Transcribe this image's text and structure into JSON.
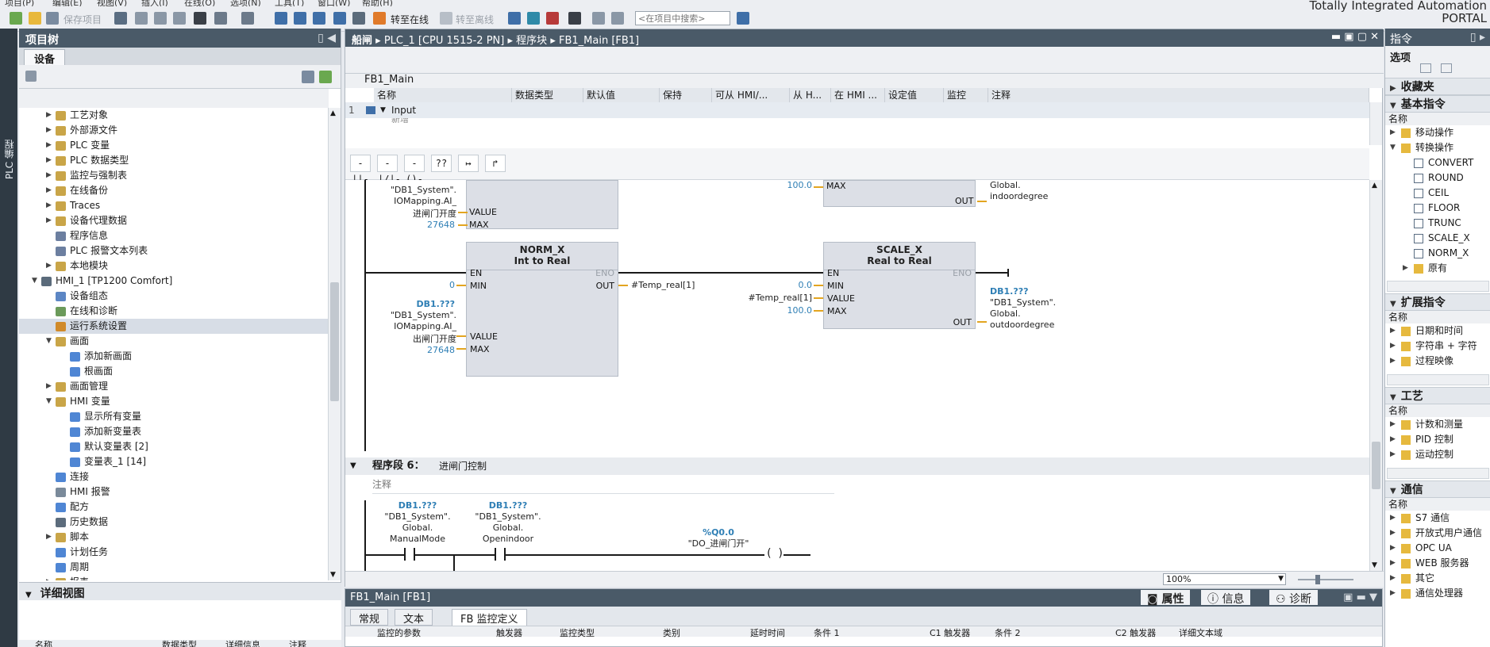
{
  "menu": [
    "项目(P)",
    "编辑(E)",
    "视图(V)",
    "插入(I)",
    "在线(O)",
    "选项(N)",
    "工具(T)",
    "窗口(W)",
    "帮助(H)"
  ],
  "brand": {
    "line1": "Totally Integrated Automation",
    "line2": "PORTAL"
  },
  "toolbar": {
    "save_project": "保存项目",
    "go_online": "转至在线",
    "go_offline": "转至离线",
    "search_placeholder": "<在项目中搜索>"
  },
  "leftstrip": {
    "label": "PLC 编程"
  },
  "project_tree": {
    "title": "项目树",
    "tab": "设备",
    "items": [
      {
        "label": "工艺对象",
        "indent": 1,
        "arrow": "right",
        "icon": "#c9a548"
      },
      {
        "label": "外部源文件",
        "indent": 1,
        "arrow": "right",
        "icon": "#c9a548"
      },
      {
        "label": "PLC 变量",
        "indent": 1,
        "arrow": "right",
        "icon": "#c9a548"
      },
      {
        "label": "PLC 数据类型",
        "indent": 1,
        "arrow": "right",
        "icon": "#c9a548"
      },
      {
        "label": "监控与强制表",
        "indent": 1,
        "arrow": "right",
        "icon": "#c9a548"
      },
      {
        "label": "在线备份",
        "indent": 1,
        "arrow": "right",
        "icon": "#c9a548"
      },
      {
        "label": "Traces",
        "indent": 1,
        "arrow": "right",
        "icon": "#c9a548"
      },
      {
        "label": "设备代理数据",
        "indent": 1,
        "arrow": "right",
        "icon": "#c9a548"
      },
      {
        "label": "程序信息",
        "indent": 1,
        "arrow": "",
        "icon": "#6c7fa0"
      },
      {
        "label": "PLC 报警文本列表",
        "indent": 1,
        "arrow": "",
        "icon": "#6c7fa0"
      },
      {
        "label": "本地模块",
        "indent": 1,
        "arrow": "right",
        "icon": "#c9a548"
      },
      {
        "label": "HMI_1 [TP1200 Comfort]",
        "indent": 0,
        "arrow": "down",
        "icon": "#5b6b7b"
      },
      {
        "label": "设备组态",
        "indent": 1,
        "arrow": "",
        "icon": "#5c86c4"
      },
      {
        "label": "在线和诊断",
        "indent": 1,
        "arrow": "",
        "icon": "#6b9a5a"
      },
      {
        "label": "运行系统设置",
        "indent": 1,
        "arrow": "",
        "icon": "#d08a2a",
        "selected": true
      },
      {
        "label": "画面",
        "indent": 1,
        "arrow": "down",
        "icon": "#c9a548"
      },
      {
        "label": "添加新画面",
        "indent": 2,
        "arrow": "",
        "icon": "#4f86d4"
      },
      {
        "label": "根画面",
        "indent": 2,
        "arrow": "",
        "icon": "#4f86d4"
      },
      {
        "label": "画面管理",
        "indent": 1,
        "arrow": "right",
        "icon": "#c9a548"
      },
      {
        "label": "HMI 变量",
        "indent": 1,
        "arrow": "down",
        "icon": "#c9a548"
      },
      {
        "label": "显示所有变量",
        "indent": 2,
        "arrow": "",
        "icon": "#4f86d4"
      },
      {
        "label": "添加新变量表",
        "indent": 2,
        "arrow": "",
        "icon": "#4f86d4"
      },
      {
        "label": "默认变量表 [2]",
        "indent": 2,
        "arrow": "",
        "icon": "#4f86d4"
      },
      {
        "label": "变量表_1 [14]",
        "indent": 2,
        "arrow": "",
        "icon": "#4f86d4"
      },
      {
        "label": "连接",
        "indent": 1,
        "arrow": "",
        "icon": "#4f86d4"
      },
      {
        "label": "HMI 报警",
        "indent": 1,
        "arrow": "",
        "icon": "#7a8a9a"
      },
      {
        "label": "配方",
        "indent": 1,
        "arrow": "",
        "icon": "#4f86d4"
      },
      {
        "label": "历史数据",
        "indent": 1,
        "arrow": "",
        "icon": "#5c6c7c"
      },
      {
        "label": "脚本",
        "indent": 1,
        "arrow": "right",
        "icon": "#c9a548"
      },
      {
        "label": "计划任务",
        "indent": 1,
        "arrow": "",
        "icon": "#4f86d4"
      },
      {
        "label": "周期",
        "indent": 1,
        "arrow": "",
        "icon": "#4f86d4"
      },
      {
        "label": "报表",
        "indent": 1,
        "arrow": "right",
        "icon": "#c9a548"
      }
    ]
  },
  "details": {
    "title": "详细视图",
    "columns": [
      "名称",
      "数据类型",
      "详细信息",
      "注释"
    ]
  },
  "editor": {
    "breadcrumb": [
      "船闸",
      "PLC_1 [CPU 1515-2 PN]",
      "程序块",
      "FB1_Main [FB1]"
    ],
    "block_name": "FB1_Main",
    "iface_headers": [
      "名称",
      "数据类型",
      "默认值",
      "保持",
      "可从 HMI/...",
      "从 H...",
      "在 HMI ...",
      "设定值",
      "监控",
      "注释"
    ],
    "iface_row": {
      "num": "1",
      "name": "Input"
    },
    "iface_row2": "新增",
    "ladder_tools": [
      "-||-",
      "-|/|-",
      "-()-",
      "??",
      "↦",
      "↱"
    ],
    "top": {
      "max_val": "100.0",
      "max_pin": "MAX",
      "out_pin": "OUT",
      "out_label": [
        "Global.",
        "indoordegree"
      ],
      "left_labels": [
        "\"DB1_System\".",
        "IOMapping.AI_",
        "进闸门开度"
      ],
      "value_pin": "VALUE",
      "max2_val": "27648",
      "max2_pin": "MAX"
    },
    "norm": {
      "title": "NORM_X",
      "sub": "Int to Real",
      "en": "EN",
      "eno": "ENO",
      "min": "MIN",
      "out": "OUT",
      "value": "VALUE",
      "max": "MAX",
      "min_val": "0",
      "out_var": "#Temp_real[1]",
      "val_db": "DB1.???",
      "val_lines": [
        "\"DB1_System\".",
        "IOMapping.AI_",
        "出闸门开度"
      ],
      "max_val": "27648"
    },
    "scale": {
      "title": "SCALE_X",
      "sub": "Real to Real",
      "en": "EN",
      "eno": "ENO",
      "min": "MIN",
      "value": "VALUE",
      "max": "MAX",
      "out": "OUT",
      "min_val": "0.0",
      "value_var": "#Temp_real[1]",
      "max_val": "100.0",
      "out_db": "DB1.???",
      "out_lines": [
        "\"DB1_System\".",
        "Global.",
        "outdoordegree"
      ]
    },
    "seg6": {
      "title": "程序段 6：",
      "name": "进闸门控制",
      "comment": "注释"
    },
    "contacts": [
      {
        "db": "DB1.???",
        "lines": [
          "\"DB1_System\".",
          "Global.",
          "ManualMode"
        ]
      },
      {
        "db": "DB1.???",
        "lines": [
          "\"DB1_System\".",
          "Global.",
          "Openindoor"
        ]
      }
    ],
    "coil": {
      "addr": "%Q0.0",
      "name": "\"DO_进闸门开\""
    },
    "zoom": "100%"
  },
  "props": {
    "title": "FB1_Main [FB1]",
    "right_tabs": [
      "属性",
      "信息",
      "诊断"
    ],
    "tabs": [
      "常规",
      "文本",
      "FB 监控定义"
    ],
    "columns": [
      "监控的参数",
      "触发器",
      "监控类型",
      "类别",
      "延时时间",
      "条件 1",
      "C1 触发器",
      "条件 2",
      "C2 触发器",
      "详细文本域"
    ]
  },
  "instructions": {
    "title": "指令",
    "options": "选项",
    "sections": {
      "favorites": "收藏夹",
      "basic": "基本指令",
      "extended": "扩展指令",
      "tech": "工艺",
      "comm": "通信"
    },
    "name_col": "名称",
    "basic_items": [
      {
        "label": "移动操作",
        "indent": 0,
        "arrow": "right",
        "folder": true
      },
      {
        "label": "转换操作",
        "indent": 0,
        "arrow": "down",
        "folder": true
      },
      {
        "label": "CONVERT",
        "indent": 1,
        "arrow": "",
        "folder": false
      },
      {
        "label": "ROUND",
        "indent": 1,
        "arrow": "",
        "folder": false
      },
      {
        "label": "CEIL",
        "indent": 1,
        "arrow": "",
        "folder": false
      },
      {
        "label": "FLOOR",
        "indent": 1,
        "arrow": "",
        "folder": false
      },
      {
        "label": "TRUNC",
        "indent": 1,
        "arrow": "",
        "folder": false
      },
      {
        "label": "SCALE_X",
        "indent": 1,
        "arrow": "",
        "folder": false
      },
      {
        "label": "NORM_X",
        "indent": 1,
        "arrow": "",
        "folder": false
      },
      {
        "label": "原有",
        "indent": 1,
        "arrow": "right",
        "folder": true
      }
    ],
    "ext_items": [
      "日期和时间",
      "字符串 + 字符",
      "过程映像"
    ],
    "tech_items": [
      "计数和测量",
      "PID 控制",
      "运动控制"
    ],
    "comm_items": [
      "S7 通信",
      "开放式用户通信",
      "OPC UA",
      "WEB 服务器",
      "其它",
      "通信处理器"
    ]
  }
}
